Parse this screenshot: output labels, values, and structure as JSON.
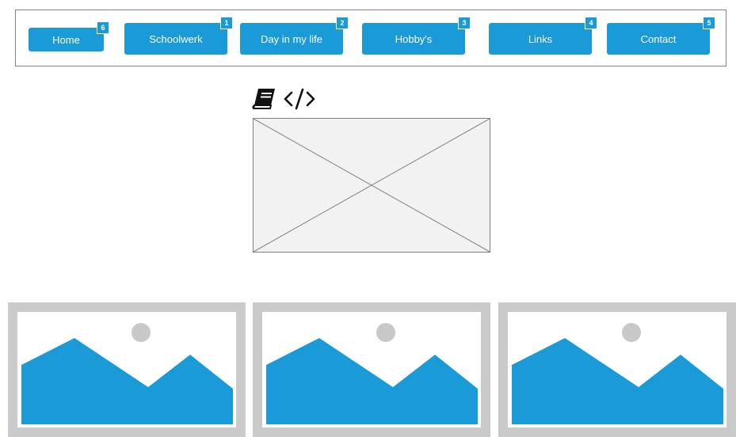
{
  "nav": {
    "items": [
      {
        "label": "Home",
        "badge": "6"
      },
      {
        "label": "Schoolwerk",
        "badge": "1"
      },
      {
        "label": "Day in my life",
        "badge": "2"
      },
      {
        "label": "Hobby's",
        "badge": "3"
      },
      {
        "label": "Links",
        "badge": "4"
      },
      {
        "label": "Contact",
        "badge": "5"
      }
    ]
  },
  "icons": {
    "book": "book-icon",
    "code": "code-icon",
    "image_placeholder": "image-placeholder-icon",
    "landscape": "landscape-image-icon"
  },
  "colors": {
    "accent": "#1a9ad6",
    "placeholder_bg": "#f2f2f2",
    "thumb_frame": "#cacaca",
    "sun": "#c8c8c8"
  }
}
